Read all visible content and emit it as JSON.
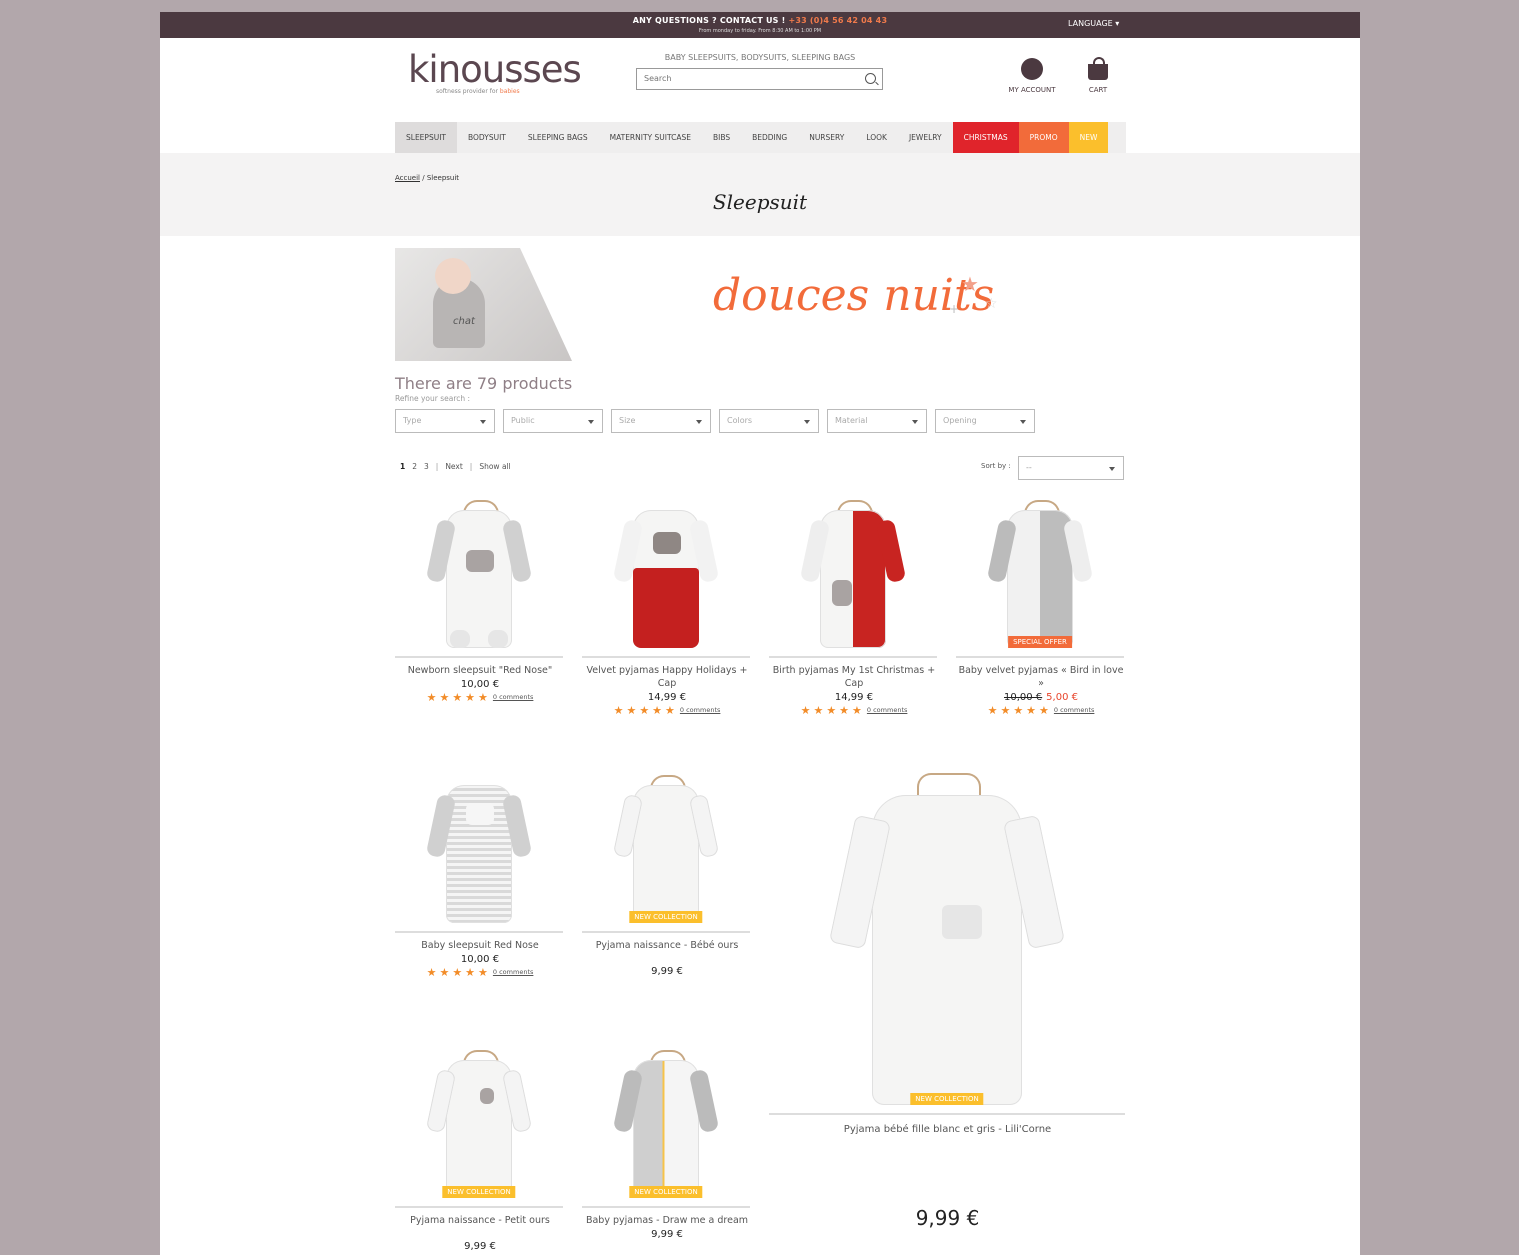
{
  "topbar": {
    "question": "ANY QUESTIONS ? CONTACT US !",
    "phone": "+33 (0)4 56 42 04 43",
    "hours": "From monday to friday. From 8:30 AM to 1:00 PM",
    "language": "LANGUAGE"
  },
  "header": {
    "logo": "kinousses",
    "tagline_prefix": "softness provider for",
    "tagline_highlight": "babies",
    "subtitle": "BABY SLEEPSUITS, BODYSUITS, SLEEPING BAGS",
    "search_placeholder": "Search",
    "account_label": "MY ACCOUNT",
    "cart_label": "CART"
  },
  "nav": [
    "SLEEPSUIT",
    "BODYSUIT",
    "SLEEPING BAGS",
    "MATERNITY SUITCASE",
    "BIBS",
    "BEDDING",
    "NURSERY",
    "LOOK",
    "JEWELRY",
    "CHRISTMAS",
    "PROMO",
    "NEW"
  ],
  "breadcrumb": {
    "home": "Accueil",
    "sep": "/",
    "current": "Sleepsuit"
  },
  "page_title": "Sleepsuit",
  "banner": {
    "slogan": "douces nuits",
    "shirt_text": "chat"
  },
  "listing": {
    "count_text": "There are 79 products",
    "refine": "Refine your search :",
    "filters": [
      "Type",
      "Public",
      "Size",
      "Colors",
      "Material",
      "Opening"
    ],
    "pages": [
      "1",
      "2",
      "3"
    ],
    "next": "Next",
    "show_all": "Show all",
    "sort_label": "Sort by :",
    "sort_value": "--"
  },
  "colors": {
    "topbar": "#4b3940",
    "accent": "#f26b3a",
    "christmas": "#e0242b",
    "new": "#fbbf2c",
    "star": "#f28c28"
  },
  "products": [
    {
      "name": "Newborn sleepsuit \"Red Nose\"",
      "price": "10,00 €",
      "stars": "★★★★★",
      "comments": "0 comments"
    },
    {
      "name": "Velvet pyjamas Happy Holidays + Cap",
      "price": "14,99 €",
      "stars": "★★★★★",
      "comments": "0 comments"
    },
    {
      "name": "Birth pyjamas My 1st Christmas + Cap",
      "price": "14,99 €",
      "stars": "★★★★★",
      "comments": "0 comments"
    },
    {
      "name": "Baby velvet pyjamas « Bird in love »",
      "old_price": "10,00 €",
      "price": "5,00 €",
      "badge": "SPECIAL OFFER",
      "stars": "★★★★★",
      "comments": "0 comments"
    },
    {
      "name": "Baby sleepsuit Red Nose",
      "price": "10,00 €",
      "stars": "★★★★★",
      "comments": "0 comments"
    },
    {
      "name": "Pyjama naissance - Bébé ours",
      "price": "9,99 €",
      "badge": "NEW COLLECTION"
    },
    {
      "name": "Pyjama bébé fille blanc et gris - Lili'Corne",
      "price": "9,99 €",
      "badge": "NEW COLLECTION"
    },
    {
      "name": "Pyjama naissance - Petit ours",
      "price": "9,99 €",
      "badge": "NEW COLLECTION"
    },
    {
      "name": "Baby pyjamas - Draw me a dream",
      "price": "9,99 €",
      "badge": "NEW COLLECTION"
    }
  ]
}
